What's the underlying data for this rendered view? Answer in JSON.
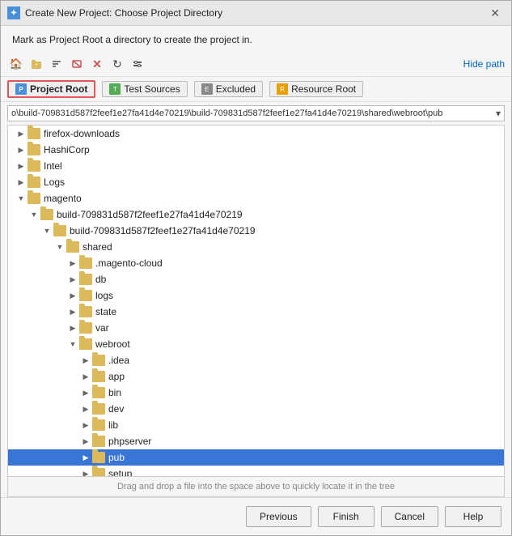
{
  "dialog": {
    "title": "Create New Project: Choose Project Directory",
    "description": "Mark as Project Root a directory to create the project in."
  },
  "toolbar": {
    "buttons": [
      {
        "name": "home-btn",
        "icon": "🏠",
        "tooltip": "Home"
      },
      {
        "name": "new-folder-btn",
        "icon": "📁",
        "tooltip": "New Folder"
      },
      {
        "name": "collapse-btn",
        "icon": "⊟",
        "tooltip": "Collapse"
      },
      {
        "name": "show-hidden-btn",
        "icon": "👁",
        "tooltip": "Show Hidden"
      },
      {
        "name": "delete-btn",
        "icon": "✕",
        "tooltip": "Delete"
      },
      {
        "name": "refresh-btn",
        "icon": "↻",
        "tooltip": "Refresh"
      },
      {
        "name": "settings-btn",
        "icon": "⚙",
        "tooltip": "Settings"
      }
    ],
    "hide_path_label": "Hide path"
  },
  "marks": [
    {
      "name": "project-root",
      "label": "Project Root",
      "icon": "P",
      "active": true
    },
    {
      "name": "test-sources",
      "label": "Test Sources",
      "icon": "T",
      "active": false
    },
    {
      "name": "excluded",
      "label": "Excluded",
      "icon": "E",
      "active": false
    },
    {
      "name": "resource-root",
      "label": "Resource Root",
      "icon": "R",
      "active": false
    }
  ],
  "path_bar": {
    "path": "o\\build-709831d587f2feef1e27fa41d4e70219\\build-709831d587f2feef1e27fa41d4e70219\\shared\\webroot\\pub"
  },
  "tree": {
    "items": [
      {
        "id": 1,
        "label": "firefox-downloads",
        "indent": "indent1",
        "arrow": "▶",
        "expanded": false,
        "selected": false
      },
      {
        "id": 2,
        "label": "HashiCorp",
        "indent": "indent1",
        "arrow": "▶",
        "expanded": false,
        "selected": false
      },
      {
        "id": 3,
        "label": "Intel",
        "indent": "indent1",
        "arrow": "▶",
        "expanded": false,
        "selected": false
      },
      {
        "id": 4,
        "label": "Logs",
        "indent": "indent1",
        "arrow": "▶",
        "expanded": false,
        "selected": false
      },
      {
        "id": 5,
        "label": "magento",
        "indent": "indent1",
        "arrow": "▼",
        "expanded": true,
        "selected": false
      },
      {
        "id": 6,
        "label": "build-709831d587f2feef1e27fa41d4e70219",
        "indent": "indent2",
        "arrow": "▼",
        "expanded": true,
        "selected": false
      },
      {
        "id": 7,
        "label": "build-709831d587f2feef1e27fa41d4e70219",
        "indent": "indent3",
        "arrow": "▼",
        "expanded": true,
        "selected": false
      },
      {
        "id": 8,
        "label": "shared",
        "indent": "indent4",
        "arrow": "▼",
        "expanded": true,
        "selected": false
      },
      {
        "id": 9,
        "label": ".magento-cloud",
        "indent": "indent5",
        "arrow": "▶",
        "expanded": false,
        "selected": false
      },
      {
        "id": 10,
        "label": "db",
        "indent": "indent5",
        "arrow": "▶",
        "expanded": false,
        "selected": false
      },
      {
        "id": 11,
        "label": "logs",
        "indent": "indent5",
        "arrow": "▶",
        "expanded": false,
        "selected": false
      },
      {
        "id": 12,
        "label": "state",
        "indent": "indent5",
        "arrow": "▶",
        "expanded": false,
        "selected": false
      },
      {
        "id": 13,
        "label": "var",
        "indent": "indent5",
        "arrow": "▶",
        "expanded": false,
        "selected": false
      },
      {
        "id": 14,
        "label": "webroot",
        "indent": "indent5",
        "arrow": "▼",
        "expanded": true,
        "selected": false
      },
      {
        "id": 15,
        "label": ".idea",
        "indent": "indent6",
        "arrow": "▶",
        "expanded": false,
        "selected": false
      },
      {
        "id": 16,
        "label": "app",
        "indent": "indent6",
        "arrow": "▶",
        "expanded": false,
        "selected": false
      },
      {
        "id": 17,
        "label": "bin",
        "indent": "indent6",
        "arrow": "▶",
        "expanded": false,
        "selected": false
      },
      {
        "id": 18,
        "label": "dev",
        "indent": "indent6",
        "arrow": "▶",
        "expanded": false,
        "selected": false
      },
      {
        "id": 19,
        "label": "lib",
        "indent": "indent6",
        "arrow": "▶",
        "expanded": false,
        "selected": false
      },
      {
        "id": 20,
        "label": "phpserver",
        "indent": "indent6",
        "arrow": "▶",
        "expanded": false,
        "selected": false
      },
      {
        "id": 21,
        "label": "pub",
        "indent": "indent6",
        "arrow": "▶",
        "expanded": false,
        "selected": true
      },
      {
        "id": 22,
        "label": "setup",
        "indent": "indent6",
        "arrow": "▶",
        "expanded": false,
        "selected": false
      }
    ]
  },
  "drag_drop_hint": "Drag and drop a file into the space above to quickly locate it in the tree",
  "footer": {
    "previous_label": "Previous",
    "finish_label": "Finish",
    "cancel_label": "Cancel",
    "help_label": "Help"
  }
}
